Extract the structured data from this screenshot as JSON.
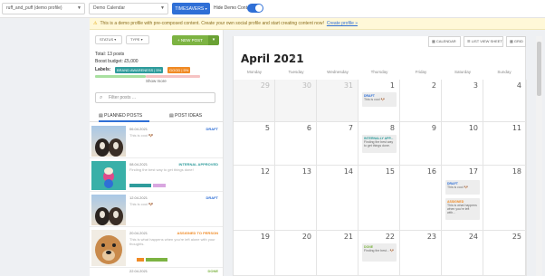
{
  "topbar": {
    "profile": "ruff_and_puff (demo profile)",
    "calendar": "Demo Calendar",
    "timesavers": "TIMESAVERS",
    "hide_demo": "Hide Demo Content"
  },
  "banner": {
    "text": "This is a demo profile with pre-composed content. Create your own social profile and start creating content now!",
    "link": "Create profile »"
  },
  "left": {
    "status_filter": "STATUS",
    "type_filter": "TYPE",
    "new_post": "+ NEW POST",
    "total": "Total: 13 posts",
    "boost": "Boost budget: £5,000",
    "labels_title": "Labels:",
    "label1": "BRAND AWARENESS | 5%",
    "label2": "GOOD | 5%",
    "show_more": "Show more",
    "filter_placeholder": "Filter posts ...",
    "tab_planned": "PLANNED POSTS",
    "tab_ideas": "POST IDEAS"
  },
  "posts": [
    {
      "date": "06.04.2021",
      "status": "DRAFT",
      "text": "This is cool 🐶",
      "status_color": "#2f6fd6"
    },
    {
      "date": "08.04.2021",
      "status": "INTERNAL APPROVED",
      "text": "Finding the best way to get things done!",
      "status_color": "#2f9c9c"
    },
    {
      "date": "12.04.2021",
      "status": "DRAFT",
      "text": "This is cool 🐶",
      "status_color": "#2f6fd6"
    },
    {
      "date": "20.04.2021",
      "status": "ASSIGNED TO PERSON",
      "text": "This is what happens when you're left alone with your thoughts.",
      "status_color": "#f08a24"
    },
    {
      "date": "22.04.2021",
      "status": "DONE",
      "text": "",
      "status_color": "#7cb342"
    }
  ],
  "calendar": {
    "month": "April 2021",
    "views": [
      "CALENDAR",
      "LIST VIEW SHEET",
      "GRID"
    ],
    "weekdays": [
      "Monday",
      "Tuesday",
      "Wednesday",
      "Thursday",
      "Friday",
      "Saturday",
      "Sunday"
    ],
    "weeks": [
      [
        "29",
        "30",
        "31",
        "1",
        "2",
        "3",
        "4"
      ],
      [
        "5",
        "6",
        "7",
        "8",
        "9",
        "10",
        "11"
      ],
      [
        "12",
        "13",
        "14",
        "15",
        "16",
        "17",
        "18"
      ],
      [
        "19",
        "20",
        "21",
        "22",
        "23",
        "24",
        "25"
      ]
    ],
    "events": [
      {
        "status": "DRAFT",
        "text": "This is cool 🐶"
      },
      {
        "status": "INTERNALLY APP...",
        "text": "Finding the best way to get things done."
      },
      {
        "status": "DRAFT",
        "text": "This is cool 🐶"
      },
      {
        "status": "ASSIGNED",
        "text": "This is what happens when you're left with..."
      },
      {
        "status": "DONE",
        "text": "Finding the best... 🐶"
      }
    ]
  }
}
